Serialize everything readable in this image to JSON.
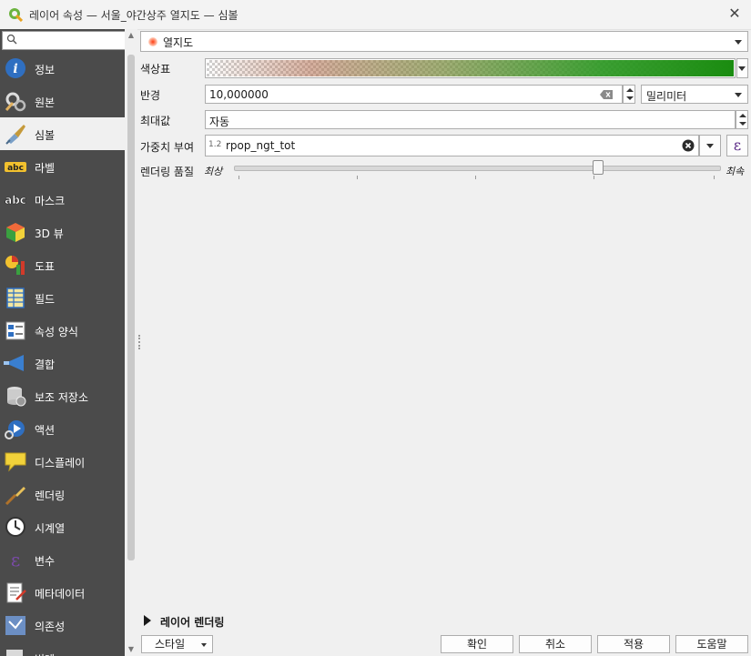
{
  "window": {
    "title": "레이어 속성 — 서울_야간상주 열지도 — 심볼",
    "close_glyph": "✕"
  },
  "search": {
    "placeholder": ""
  },
  "sidebar": {
    "items": [
      {
        "label": "정보",
        "icon": "info-icon"
      },
      {
        "label": "원본",
        "icon": "source-settings-icon"
      },
      {
        "label": "심볼",
        "icon": "paintbrush-icon",
        "active": true
      },
      {
        "label": "라벨",
        "icon": "abc-label-icon"
      },
      {
        "label": "마스크",
        "icon": "abc-mask-icon"
      },
      {
        "label": "3D 뷰",
        "icon": "cube-3d-icon"
      },
      {
        "label": "도표",
        "icon": "diagram-icon"
      },
      {
        "label": "필드",
        "icon": "fields-table-icon"
      },
      {
        "label": "속성 양식",
        "icon": "attribute-form-icon"
      },
      {
        "label": "결합",
        "icon": "join-icon"
      },
      {
        "label": "보조 저장소",
        "icon": "auxiliary-storage-icon"
      },
      {
        "label": "액션",
        "icon": "action-gear-icon"
      },
      {
        "label": "디스플레이",
        "icon": "display-tooltip-icon"
      },
      {
        "label": "렌더링",
        "icon": "rendering-brush-icon"
      },
      {
        "label": "시계열",
        "icon": "clock-icon"
      },
      {
        "label": "변수",
        "icon": "epsilon-variable-icon"
      },
      {
        "label": "메타데이터",
        "icon": "metadata-icon"
      },
      {
        "label": "의존성",
        "icon": "dependencies-icon"
      },
      {
        "label": "범례",
        "icon": "legend-icon"
      }
    ]
  },
  "renderer": {
    "selected": "열지도",
    "accent": "#e8551f"
  },
  "form": {
    "color_ramp_label": "색상표",
    "color_ramp_end": "#1a8c10",
    "radius_label": "반경",
    "radius_value": "10,000000",
    "radius_unit": "밀리미터",
    "max_label": "최대값",
    "max_value": "자동",
    "weight_label": "가중치 부여",
    "weight_type_badge": "1.2",
    "weight_field": "rpop_ngt_tot",
    "expression_glyph": "ε",
    "quality_label": "렌더링 품질",
    "quality_min": "최상",
    "quality_max": "최속",
    "quality_position": 0.75
  },
  "layer_rendering": {
    "label": "레이어 렌더링"
  },
  "footer": {
    "style_label": "스타일",
    "ok_label": "확인",
    "cancel_label": "취소",
    "apply_label": "적용",
    "help_label": "도움말"
  }
}
